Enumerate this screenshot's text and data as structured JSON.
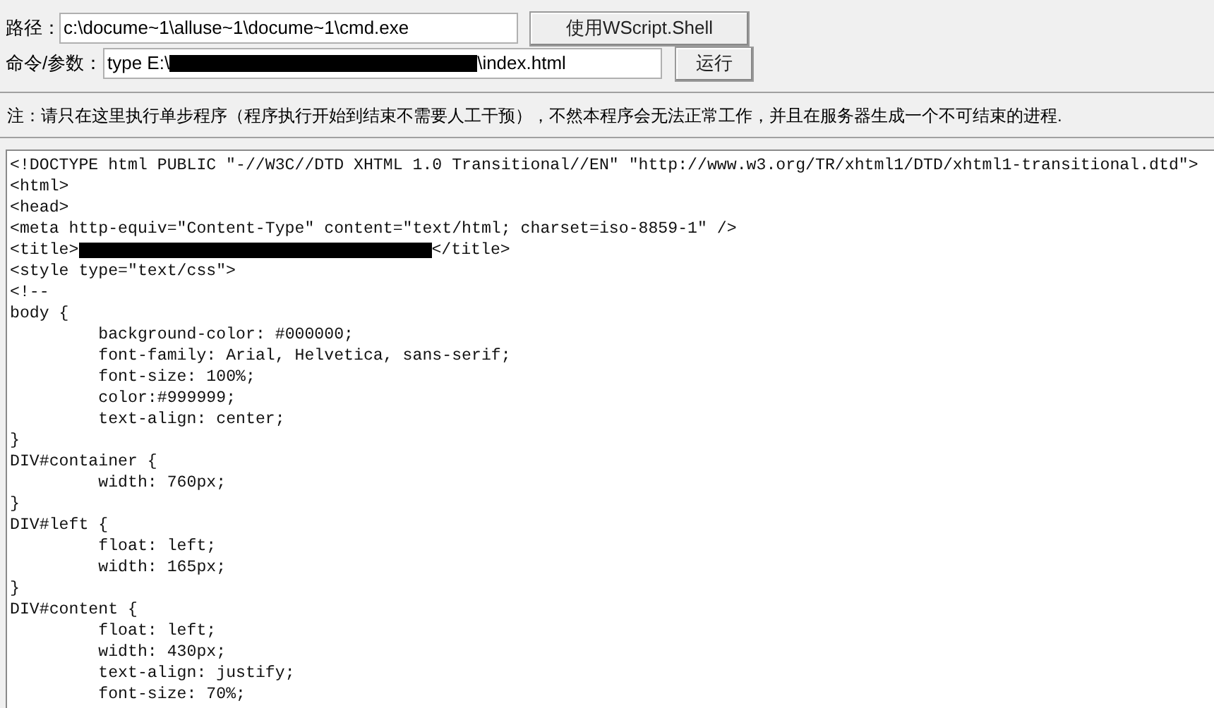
{
  "path_field": {
    "label": "路径：",
    "value": "c:\\docume~1\\alluse~1\\docume~1\\cmd.exe"
  },
  "wscript_button": {
    "label": "使用WScript.Shell"
  },
  "command_field": {
    "label": "命令/参数：",
    "value_before": "type E:\\",
    "value_after": "\\index.html"
  },
  "run_button": {
    "label": "运行"
  },
  "note": "注：请只在这里执行单步程序（程序执行开始到结束不需要人工干预），不然本程序会无法正常工作，并且在服务器生成一个不可结束的进程.",
  "output_lines": [
    {
      "kind": "text",
      "text": "<!DOCTYPE html PUBLIC \"-//W3C//DTD XHTML 1.0 Transitional//EN\" \"http://www.w3.org/TR/xhtml1/DTD/xhtml1-transitional.dtd\">"
    },
    {
      "kind": "text",
      "text": "<html>"
    },
    {
      "kind": "text",
      "text": "<head>"
    },
    {
      "kind": "text",
      "text": "<meta http-equiv=\"Content-Type\" content=\"text/html; charset=iso-8859-1\" />"
    },
    {
      "kind": "redacted",
      "before": "<title>",
      "after": "</title>"
    },
    {
      "kind": "text",
      "text": "<style type=\"text/css\">"
    },
    {
      "kind": "text",
      "text": "<!--"
    },
    {
      "kind": "text",
      "text": "body {"
    },
    {
      "kind": "text",
      "text": "\tbackground-color: #000000;"
    },
    {
      "kind": "text",
      "text": "\tfont-family: Arial, Helvetica, sans-serif;"
    },
    {
      "kind": "text",
      "text": "\tfont-size: 100%;"
    },
    {
      "kind": "text",
      "text": "\tcolor:#999999;"
    },
    {
      "kind": "text",
      "text": "\ttext-align: center;"
    },
    {
      "kind": "text",
      "text": "}"
    },
    {
      "kind": "text",
      "text": "DIV#container {"
    },
    {
      "kind": "text",
      "text": "\twidth: 760px;"
    },
    {
      "kind": "text",
      "text": "}"
    },
    {
      "kind": "text",
      "text": "DIV#left {"
    },
    {
      "kind": "text",
      "text": "\tfloat: left;"
    },
    {
      "kind": "text",
      "text": "\twidth: 165px;"
    },
    {
      "kind": "text",
      "text": "}"
    },
    {
      "kind": "text",
      "text": "DIV#content {"
    },
    {
      "kind": "text",
      "text": "\tfloat: left;"
    },
    {
      "kind": "text",
      "text": "\twidth: 430px;"
    },
    {
      "kind": "text",
      "text": "\ttext-align: justify;"
    },
    {
      "kind": "text",
      "text": "\tfont-size: 70%;"
    }
  ]
}
